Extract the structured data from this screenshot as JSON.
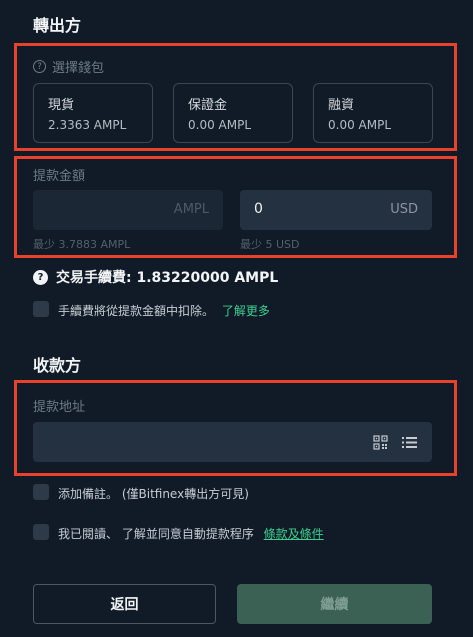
{
  "sender": {
    "title": "轉出方",
    "wallet_label": "選擇錢包",
    "wallets": [
      {
        "name": "現貨",
        "balance": "2.3363 AMPL"
      },
      {
        "name": "保證金",
        "balance": "0.00 AMPL"
      },
      {
        "name": "融資",
        "balance": "0.00 AMPL"
      }
    ],
    "amount_label": "提款金額",
    "ampl_input": {
      "value": "",
      "currency": "AMPL",
      "min": "最少 3.7883 AMPL"
    },
    "usd_input": {
      "value": "0",
      "currency": "USD",
      "min": "最少 5 USD"
    },
    "fee_text": "交易手續費: 1.83220000 AMPL",
    "deduct_text": "手續費將從提款金額中扣除。",
    "learn_more": "了解更多"
  },
  "receiver": {
    "title": "收款方",
    "address_label": "提款地址",
    "address_value": "",
    "memo_text": "添加備註。 (僅Bitfinex轉出方可見)",
    "agree_text": "我已閱讀、 了解並同意自動提款程序",
    "terms_link": "條款及條件"
  },
  "buttons": {
    "back": "返回",
    "continue": "繼續"
  },
  "colors": {
    "background": "#101b27",
    "highlight": "#e8412c",
    "accent_green": "#3ecf8e",
    "continue_bg": "#3b6154"
  }
}
